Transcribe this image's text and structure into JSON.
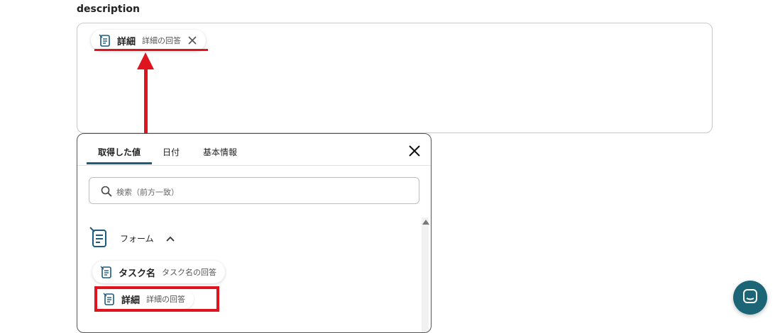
{
  "field": {
    "label": "description"
  },
  "description_chip": {
    "name": "詳細",
    "sub": "詳細の回答",
    "icon": "form-icon",
    "remove_icon": "close-icon"
  },
  "panel": {
    "tabs": [
      {
        "label": "取得した値",
        "active": true
      },
      {
        "label": "日付",
        "active": false
      },
      {
        "label": "基本情報",
        "active": false
      }
    ],
    "close_icon": "close-icon",
    "search": {
      "placeholder": "検索（前方一致）",
      "icon": "search-icon"
    },
    "group": {
      "label": "フォーム",
      "icon": "form-icon",
      "expand_icon": "chevron-up-icon"
    },
    "items": [
      {
        "name": "タスク名",
        "sub": "タスク名の回答"
      },
      {
        "name": "詳細",
        "sub": "詳細の回答"
      }
    ]
  },
  "help_button": {
    "icon": "chat-icon"
  },
  "colors": {
    "accent": "#1c5a7e",
    "annotation": "#e0141e",
    "help": "#1b6577"
  }
}
